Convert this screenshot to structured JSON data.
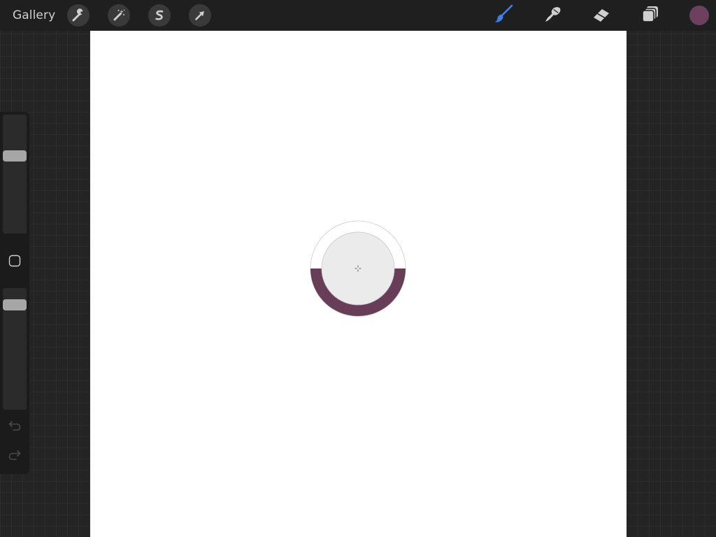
{
  "toolbar": {
    "gallery_label": "Gallery",
    "left_tools": [
      {
        "name": "actions",
        "icon": "wrench-icon"
      },
      {
        "name": "adjustments",
        "icon": "magic-wand-icon"
      },
      {
        "name": "selection",
        "icon": "selection-s-icon"
      },
      {
        "name": "transform",
        "icon": "arrow-cursor-icon"
      }
    ],
    "right_tools": [
      {
        "name": "brush",
        "icon": "brush-icon",
        "active": true
      },
      {
        "name": "smudge",
        "icon": "smudge-finger-icon",
        "active": false
      },
      {
        "name": "eraser",
        "icon": "eraser-icon",
        "active": false
      },
      {
        "name": "layers",
        "icon": "layers-icon",
        "active": false
      }
    ],
    "current_color": "#6e3f5e"
  },
  "sidebar": {
    "brush_size_slider": {
      "icon": "slider-thumb",
      "level": 0.67
    },
    "modify_button": {
      "icon": "rounded-square-icon"
    },
    "opacity_slider": {
      "icon": "slider-thumb",
      "level": 0.9
    },
    "undo": {
      "icon": "undo-arrow-icon"
    },
    "redo": {
      "icon": "redo-arrow-icon"
    }
  },
  "canvas": {
    "background": "#ffffff"
  },
  "color_drop": {
    "fill_level": 0.5,
    "fill_color": "#673d58",
    "icon": "crosshair-icon"
  },
  "colors": {
    "accent_active_tool": "#3d7ef0",
    "toolbar_bg": "#1f1f1f",
    "workspace_bg": "#242424",
    "icon_gray": "#cfcfcf"
  }
}
